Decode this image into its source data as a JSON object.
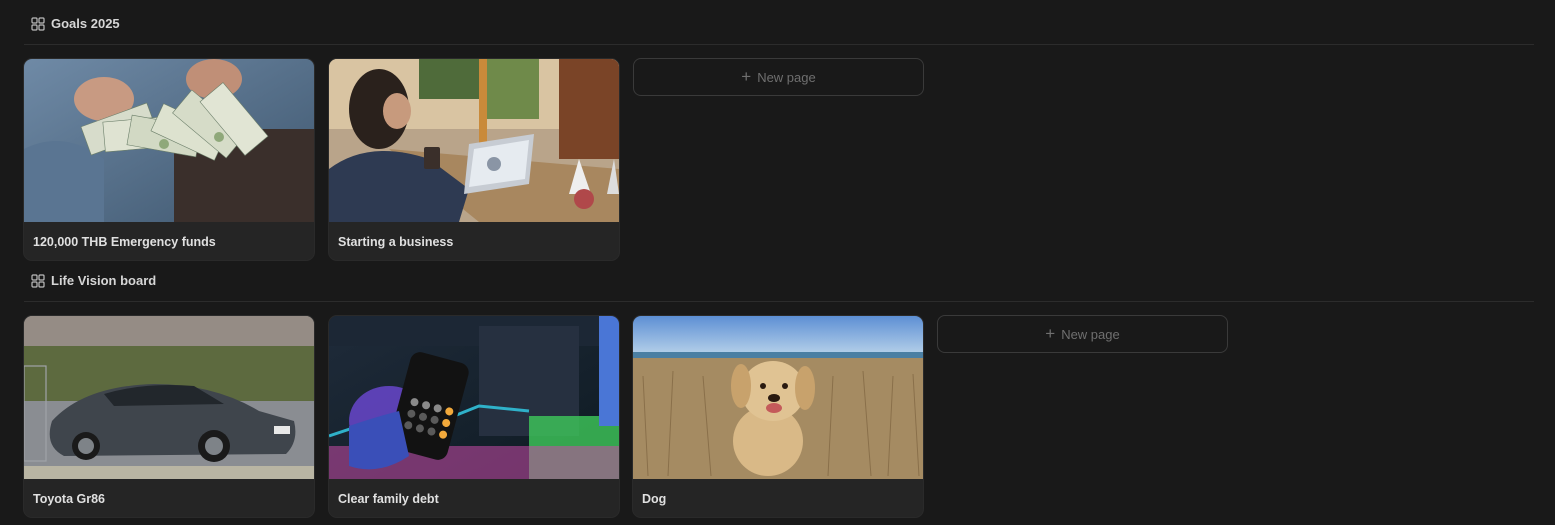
{
  "sections": [
    {
      "title": "Goals 2025",
      "cards": [
        {
          "title": "120,000 THB Emergency funds"
        },
        {
          "title": "Starting a business"
        }
      ],
      "new_page_label": "New page"
    },
    {
      "title": "Life Vision board",
      "cards": [
        {
          "title": "Toyota Gr86"
        },
        {
          "title": "Clear family debt"
        },
        {
          "title": "Dog"
        }
      ],
      "new_page_label": "New page"
    }
  ],
  "icons": {
    "gallery": "gallery-view-icon",
    "plus": "plus-icon"
  },
  "colors": {
    "background": "#191919",
    "card": "#252525",
    "text": "#e0e0e0",
    "muted": "#6f6f6f"
  }
}
